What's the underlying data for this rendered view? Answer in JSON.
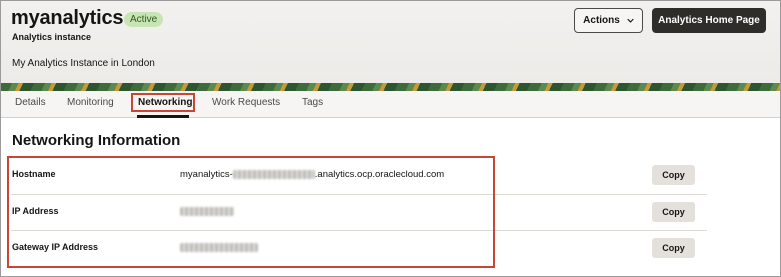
{
  "header": {
    "title": "myanalytics",
    "status_badge": "Active",
    "subtitle": "Analytics instance",
    "description": "My Analytics Instance in London",
    "actions_label": "Actions",
    "home_button_label": "Analytics Home Page"
  },
  "tabs": [
    {
      "label": "Details",
      "active": false
    },
    {
      "label": "Monitoring",
      "active": false
    },
    {
      "label": "Networking",
      "active": true
    },
    {
      "label": "Work Requests",
      "active": false
    },
    {
      "label": "Tags",
      "active": false
    }
  ],
  "networking": {
    "section_title": "Networking Information",
    "rows": [
      {
        "label": "Hostname",
        "value_prefix": "myanalytics-",
        "value_suffix": ".analytics.ocp.oraclecloud.com",
        "copy_label": "Copy"
      },
      {
        "label": "IP Address",
        "value_prefix": "",
        "value_suffix": "",
        "copy_label": "Copy"
      },
      {
        "label": "Gateway IP Address",
        "value_prefix": "",
        "value_suffix": "",
        "copy_label": "Copy"
      }
    ]
  },
  "colors": {
    "highlight": "#c74634",
    "badge_bg": "#c7e5b4",
    "primary_button": "#2f2d2a"
  },
  "icons": {
    "actions_dropdown": "chevron-down-icon"
  }
}
